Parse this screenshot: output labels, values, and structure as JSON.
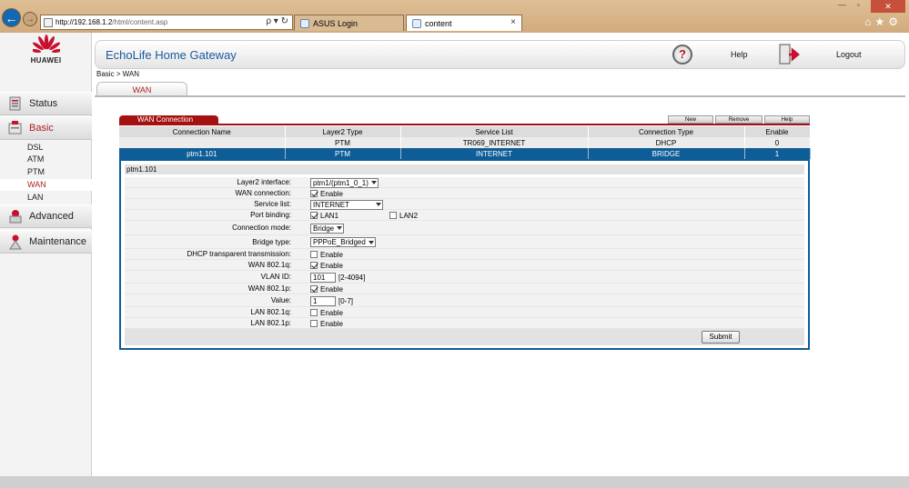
{
  "browser": {
    "back_glyph": "←",
    "forward_glyph": "→",
    "url_host": "http://192.168.1.2",
    "url_path": "/html/content.asp",
    "address_tools": "ρ ▾ ↻",
    "tabs": [
      {
        "label": "ASUS Login"
      },
      {
        "label": "content"
      }
    ],
    "tab_close": "×",
    "window_controls": [
      "—",
      "▫",
      "✕"
    ],
    "toolbar_icons": "⌂★⚙"
  },
  "brand": {
    "name": "HUAWEI",
    "color": "#c8102e",
    "app_title": "EchoLife Home Gateway"
  },
  "header": {
    "help_glyph": "?",
    "help_label": "Help",
    "logout_label": "Logout"
  },
  "sidebar": {
    "items": [
      {
        "label": "Status",
        "icon": "status-icon"
      },
      {
        "label": "Basic",
        "icon": "basic-icon",
        "active": true
      },
      {
        "label": "Advanced",
        "icon": "advanced-icon"
      },
      {
        "label": "Maintenance",
        "icon": "maintenance-icon"
      }
    ],
    "submenu": [
      "DSL",
      "ATM",
      "PTM",
      "WAN",
      "LAN"
    ],
    "submenu_active": "WAN"
  },
  "breadcrumb": "Basic > WAN",
  "page_tab": "WAN",
  "wan": {
    "section_title": "WAN Connection",
    "buttons": {
      "new": "New",
      "remove": "Remove",
      "help": "Help"
    },
    "columns": [
      "Connection Name",
      "Layer2 Type",
      "Service List",
      "Connection Type",
      "Enable"
    ],
    "rows": [
      [
        "",
        "PTM",
        "TR069_INTERNET",
        "DHCP",
        "0"
      ],
      [
        "ptm1.101",
        "PTM",
        "INTERNET",
        "BRIDGE",
        "1"
      ]
    ],
    "selected_row": 1
  },
  "detail": {
    "title": "ptm1.101",
    "fields": {
      "layer2_interface": {
        "label": "Layer2 interface:",
        "value": "ptm1/(ptm1_0_1)"
      },
      "wan_connection": {
        "label": "WAN connection:",
        "checked": true,
        "text": "Enable"
      },
      "service_list": {
        "label": "Service list:",
        "value": "INTERNET"
      },
      "port_binding": {
        "label": "Port binding:",
        "lan1": "LAN1",
        "lan1_checked": true,
        "lan2": "LAN2",
        "lan2_checked": false
      },
      "connection_mode": {
        "label": "Connection mode:",
        "value": "Bridge"
      },
      "bridge_type": {
        "label": "Bridge type:",
        "value": "PPPoE_Bridged"
      },
      "dhcp_transparent": {
        "label": "DHCP transparent transmission:",
        "checked": false,
        "text": "Enable"
      },
      "wan_8021q": {
        "label": "WAN 802.1q:",
        "checked": true,
        "text": "Enable"
      },
      "vlan_id": {
        "label": "VLAN ID:",
        "value": "101",
        "range": "[2-4094]"
      },
      "wan_8021p": {
        "label": "WAN 802.1p:",
        "checked": true,
        "text": "Enable"
      },
      "priority_value": {
        "label": "Value:",
        "value": "1",
        "range": "[0-7]"
      },
      "lan_8021q": {
        "label": "LAN 802.1q:",
        "checked": false,
        "text": "Enable"
      },
      "lan_8021p": {
        "label": "LAN 802.1p:",
        "checked": false,
        "text": "Enable"
      }
    },
    "submit_label": "Submit"
  },
  "colors": {
    "accent_red": "#a51111",
    "selected_blue": "#0e5d97",
    "title_blue": "#1b5aa0"
  }
}
